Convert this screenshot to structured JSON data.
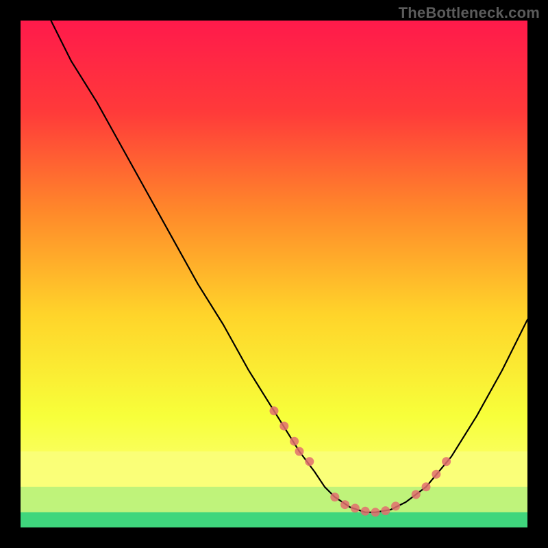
{
  "watermark": "TheBottleneck.com",
  "chart_data": {
    "type": "line",
    "title": "",
    "xlabel": "",
    "ylabel": "",
    "xlim": [
      0,
      100
    ],
    "ylim": [
      0,
      100
    ],
    "curve": {
      "x": [
        6,
        10,
        15,
        20,
        25,
        30,
        35,
        40,
        45,
        50,
        55,
        58,
        60,
        62,
        65,
        68,
        70,
        73,
        76,
        80,
        85,
        90,
        95,
        100
      ],
      "y": [
        100,
        92,
        84,
        75,
        66,
        57,
        48,
        40,
        31,
        23,
        15,
        11,
        8,
        6,
        4,
        3,
        3,
        3.5,
        5,
        8,
        14,
        22,
        31,
        41
      ]
    },
    "markers": {
      "x": [
        50,
        52,
        54,
        55,
        57,
        62,
        64,
        66,
        68,
        70,
        72,
        74,
        78,
        80,
        82,
        84
      ],
      "y": [
        23,
        20,
        17,
        15,
        13,
        6,
        4.5,
        3.8,
        3.2,
        3,
        3.3,
        4.2,
        6.5,
        8,
        10.5,
        13
      ]
    },
    "bands": [
      {
        "y0": 0,
        "y1": 3,
        "color": "#2ad17a"
      },
      {
        "y0": 3,
        "y1": 8,
        "color": "#b8f27a"
      },
      {
        "y0": 8,
        "y1": 15,
        "color": "#faff7a"
      }
    ],
    "gradient_stops": [
      {
        "offset": 0,
        "color": "#ff1a4b"
      },
      {
        "offset": 18,
        "color": "#ff3a3a"
      },
      {
        "offset": 38,
        "color": "#ff8a2a"
      },
      {
        "offset": 58,
        "color": "#ffd42a"
      },
      {
        "offset": 78,
        "color": "#f7ff3a"
      },
      {
        "offset": 100,
        "color": "#ffff9a"
      }
    ],
    "marker_color": "#e26f6f",
    "curve_color": "#000000"
  }
}
